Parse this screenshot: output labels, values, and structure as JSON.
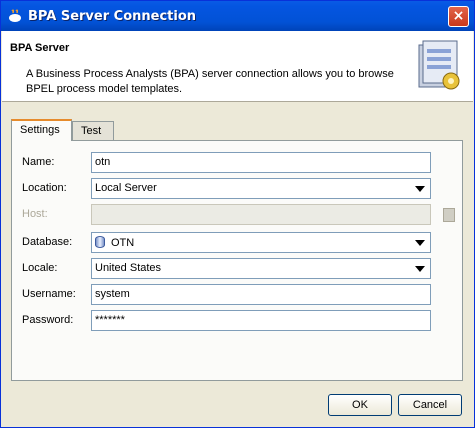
{
  "window": {
    "title": "BPA Server Connection",
    "close_glyph": "×"
  },
  "header": {
    "title": "BPA Server",
    "description": "A Business Process Analysts (BPA) server connection allows you to browse BPEL process model templates.",
    "icon": "server-connection-icon"
  },
  "tabs": [
    {
      "label": "Settings",
      "active": true
    },
    {
      "label": "Test",
      "active": false
    }
  ],
  "form": {
    "name": {
      "label": "Name:",
      "value": "otn"
    },
    "location": {
      "label": "Location:",
      "value": "Local Server"
    },
    "host": {
      "label": "Host:",
      "value": ""
    },
    "database": {
      "label": "Database:",
      "value": "OTN",
      "icon": "database-icon"
    },
    "locale": {
      "label": "Locale:",
      "value": "United States"
    },
    "username": {
      "label": "Username:",
      "value": "system"
    },
    "password": {
      "label": "Password:",
      "value": "*******"
    }
  },
  "buttons": {
    "ok": "OK",
    "cancel": "Cancel"
  },
  "colors": {
    "title_bar": "#0455e0",
    "tab_highlight": "#e68b2c",
    "field_border": "#7f9db9"
  }
}
